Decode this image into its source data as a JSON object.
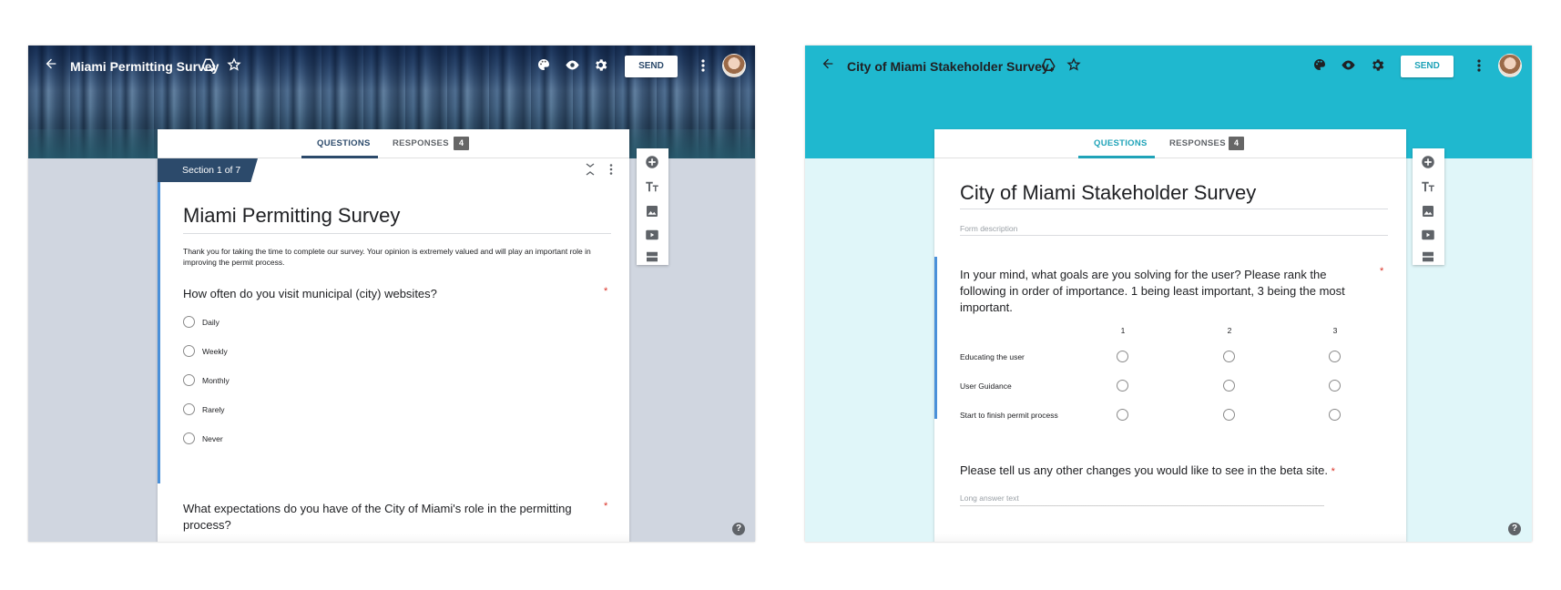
{
  "left": {
    "app_title": "Miami Permitting Survey",
    "send_label": "SEND",
    "tabs": [
      {
        "label": "QUESTIONS"
      },
      {
        "label": "RESPONSES",
        "badge": "4"
      }
    ],
    "section_tag": "Section 1 of 7",
    "form_title": "Miami Permitting Survey",
    "description": "Thank you for taking the time to complete our survey. Your opinion is extremely valued and will play an important role in improving the permit process.",
    "question1": {
      "text": "How often do you visit municipal (city) websites?",
      "required_mark": "*",
      "options": [
        "Daily",
        "Weekly",
        "Monthly",
        "Rarely",
        "Never"
      ]
    },
    "question2": {
      "text": "What expectations do you have of the City of Miami's role in the permitting process?",
      "required_mark": "*"
    },
    "help_label": "?"
  },
  "right": {
    "app_title": "City of Miami Stakeholder Survey",
    "send_label": "SEND",
    "tabs": [
      {
        "label": "QUESTIONS"
      },
      {
        "label": "RESPONSES",
        "badge": "4"
      }
    ],
    "form_title": "City of Miami Stakeholder Survey",
    "description_placeholder": "Form description",
    "question1": {
      "text": "In your mind, what goals are you solving for the user? Please rank the following in order of importance. 1 being least important, 3 being the most important.",
      "required_mark": "*",
      "columns": [
        "1",
        "2",
        "3"
      ],
      "rows": [
        "Educating the user",
        "User Guidance",
        "Start to finish permit process"
      ]
    },
    "question2": {
      "text": "Please tell us any other changes you would like to see in the beta site.",
      "required_mark": "*",
      "placeholder": "Long answer text"
    },
    "help_label": "?"
  },
  "colors": {
    "left_accent": "#2c4a6b",
    "right_accent": "#1fb8cf",
    "left_bg": "#d0d6e0",
    "right_bg": "#e0f6f9"
  }
}
